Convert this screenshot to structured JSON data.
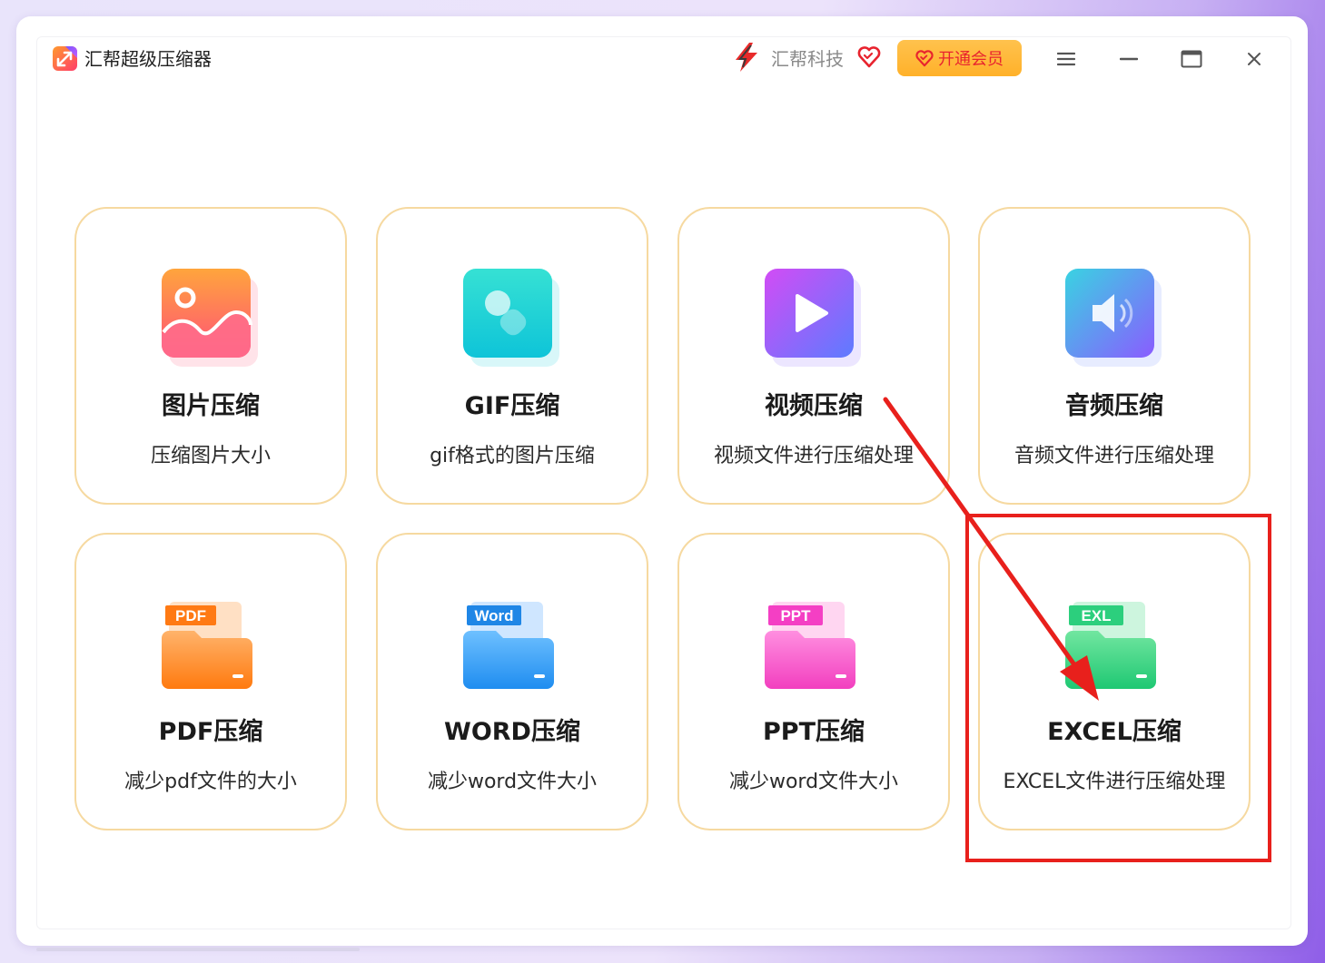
{
  "app": {
    "title": "汇帮超级压缩器",
    "icon": "app-logo-icon"
  },
  "header": {
    "brand_name": "汇帮科技",
    "brand_icon": "lightning-logo-icon",
    "heart_icon": "heart-icon",
    "vip_label": "开通会员",
    "accent_color": "#ffb52e",
    "vip_text_color": "#e8232e"
  },
  "window_controls": {
    "menu_icon": "menu-icon",
    "minimize_icon": "minimize-icon",
    "maximize_icon": "maximize-icon",
    "close_icon": "close-icon"
  },
  "tools": [
    {
      "title": "图片压缩",
      "desc": "压缩图片大小",
      "icon": "image-icon"
    },
    {
      "title": "GIF压缩",
      "desc": "gif格式的图片压缩",
      "icon": "gif-icon"
    },
    {
      "title": "视频压缩",
      "desc": "视频文件进行压缩处理",
      "icon": "video-play-icon"
    },
    {
      "title": "音频压缩",
      "desc": "音频文件进行压缩处理",
      "icon": "speaker-icon"
    },
    {
      "title": "PDF压缩",
      "desc": "减少pdf文件的大小",
      "icon": "pdf-folder-icon",
      "badge": "PDF"
    },
    {
      "title": "WORD压缩",
      "desc": "减少word文件大小",
      "icon": "word-folder-icon",
      "badge": "Word"
    },
    {
      "title": "PPT压缩",
      "desc": "减少word文件大小",
      "icon": "ppt-folder-icon",
      "badge": "PPT"
    },
    {
      "title": "EXCEL压缩",
      "desc": "EXCEL文件进行压缩处理",
      "icon": "excel-folder-icon",
      "badge": "EXL"
    }
  ],
  "colors": {
    "card_border": "#f6d9a0",
    "annotation_red": "#e8201c"
  }
}
